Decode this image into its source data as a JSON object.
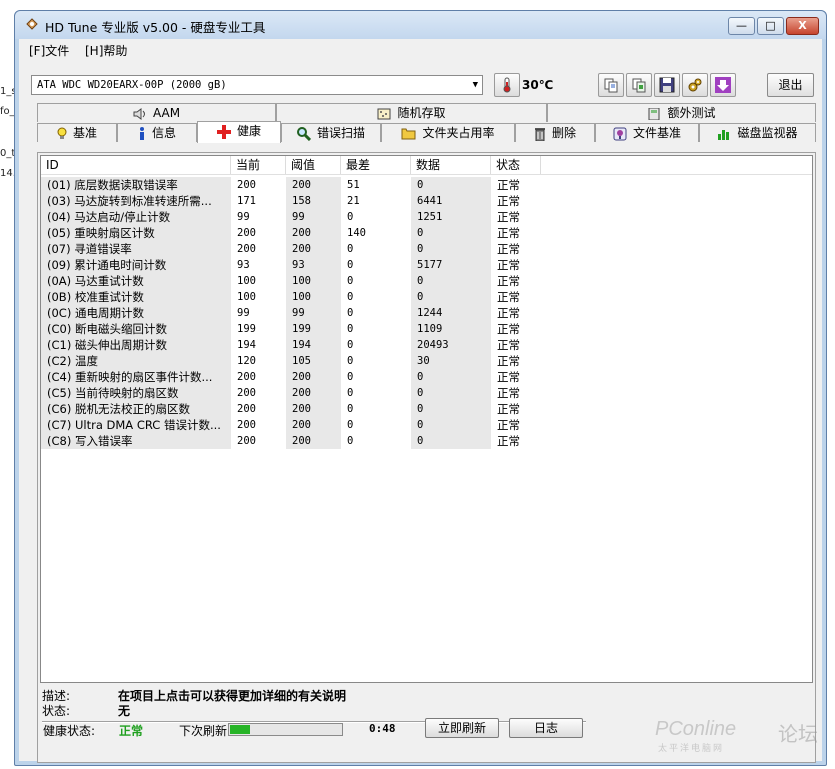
{
  "background_fragments": [
    "1_s",
    "fo_",
    "0_t",
    "14."
  ],
  "window": {
    "title": "HD Tune 专业版 v5.00 - 硬盘专业工具",
    "controls": {
      "minimize": "—",
      "maximize": "□",
      "close": "X"
    }
  },
  "menu": {
    "file": "[F]文件",
    "help": "[H]帮助"
  },
  "toolbar": {
    "drive": "ATA    WDC WD20EARX-00P (2000 gB)",
    "temperature": "30℃",
    "exit_label": "退出"
  },
  "tabs": {
    "row1": [
      {
        "label": "AAM",
        "icon": "speaker-icon"
      },
      {
        "label": "随机存取",
        "icon": "random-access-icon"
      },
      {
        "label": "额外测试",
        "icon": "calculator-icon"
      }
    ],
    "row2": [
      {
        "label": "基准",
        "icon": "bulb-icon"
      },
      {
        "label": "信息",
        "icon": "info-icon"
      },
      {
        "label": "健康",
        "icon": "health-cross-icon"
      },
      {
        "label": "错误扫描",
        "icon": "magnifier-icon"
      },
      {
        "label": "文件夹占用率",
        "icon": "folder-icon"
      },
      {
        "label": "删除",
        "icon": "trash-icon"
      },
      {
        "label": "文件基准",
        "icon": "file-benchmark-icon"
      },
      {
        "label": "磁盘监视器",
        "icon": "bar-monitor-icon"
      }
    ],
    "active": "健康"
  },
  "table": {
    "headers": [
      "ID",
      "当前",
      "阈值",
      "最差",
      "数据",
      "状态"
    ],
    "rows": [
      [
        "(01) 底层数据读取错误率",
        "200",
        "200",
        "51",
        "0",
        "正常"
      ],
      [
        "(03) 马达旋转到标准转速所需...",
        "171",
        "158",
        "21",
        "6441",
        "正常"
      ],
      [
        "(04) 马达启动/停止计数",
        "99",
        "99",
        "0",
        "1251",
        "正常"
      ],
      [
        "(05) 重映射扇区计数",
        "200",
        "200",
        "140",
        "0",
        "正常"
      ],
      [
        "(07) 寻道错误率",
        "200",
        "200",
        "0",
        "0",
        "正常"
      ],
      [
        "(09) 累计通电时间计数",
        "93",
        "93",
        "0",
        "5177",
        "正常"
      ],
      [
        "(0A) 马达重试计数",
        "100",
        "100",
        "0",
        "0",
        "正常"
      ],
      [
        "(0B) 校准重试计数",
        "100",
        "100",
        "0",
        "0",
        "正常"
      ],
      [
        "(0C) 通电周期计数",
        "99",
        "99",
        "0",
        "1244",
        "正常"
      ],
      [
        "(C0) 断电磁头缩回计数",
        "199",
        "199",
        "0",
        "1109",
        "正常"
      ],
      [
        "(C1) 磁头伸出周期计数",
        "194",
        "194",
        "0",
        "20493",
        "正常"
      ],
      [
        "(C2) 温度",
        "120",
        "105",
        "0",
        "30",
        "正常"
      ],
      [
        "(C4) 重新映射的扇区事件计数...",
        "200",
        "200",
        "0",
        "0",
        "正常"
      ],
      [
        "(C5) 当前待映射的扇区数",
        "200",
        "200",
        "0",
        "0",
        "正常"
      ],
      [
        "(C6) 脱机无法校正的扇区数",
        "200",
        "200",
        "0",
        "0",
        "正常"
      ],
      [
        "(C7) Ultra DMA CRC 错误计数...",
        "200",
        "200",
        "0",
        "0",
        "正常"
      ],
      [
        "(C8) 写入错误率",
        "200",
        "200",
        "0",
        "0",
        "正常"
      ]
    ]
  },
  "description": {
    "desc_label": "描述:",
    "desc_value": "在项目上点击可以获得更加详细的有关说明",
    "status_label": "状态:",
    "status_value": "无"
  },
  "footer": {
    "health_label": "健康状态:",
    "health_value": "正常",
    "refresh_label": "下次刷新:",
    "refresh_progress": 0.18,
    "countdown": "0:48",
    "refresh_now": "立即刷新",
    "log": "日志"
  },
  "watermark": {
    "brand": "PConline",
    "brand_sub": "太平洋电脑网",
    "forum": "论坛"
  },
  "colors": {
    "health_ok": "#20a020",
    "progress": "#27b427",
    "close_button": "#c6442e"
  }
}
